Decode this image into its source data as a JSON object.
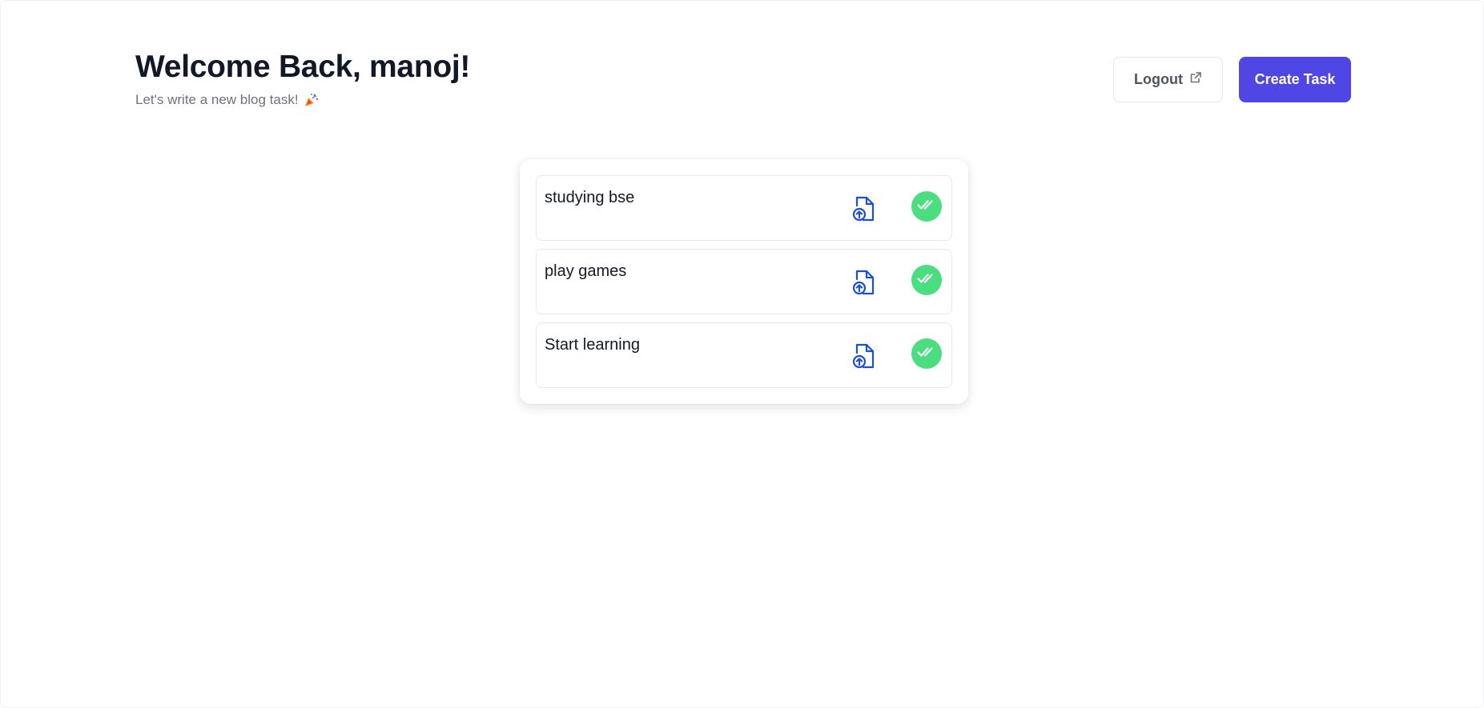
{
  "header": {
    "title": "Welcome Back, manoj!",
    "subtitle": "Let's write a new blog task!",
    "subtitle_icon": "party-popper-icon"
  },
  "actions": {
    "logout_label": "Logout",
    "logout_icon": "external-link-icon",
    "create_label": "Create Task"
  },
  "colors": {
    "primary": "#4f46e5",
    "success": "#4ade80",
    "upload_icon": "#1d4ed8",
    "muted_text": "#6b7280"
  },
  "tasks": [
    {
      "text": "studying bse",
      "upload_icon": "file-upload-icon",
      "done_icon": "double-check-icon"
    },
    {
      "text": "play games",
      "upload_icon": "file-upload-icon",
      "done_icon": "double-check-icon"
    },
    {
      "text": "Start learning",
      "upload_icon": "file-upload-icon",
      "done_icon": "double-check-icon"
    }
  ]
}
